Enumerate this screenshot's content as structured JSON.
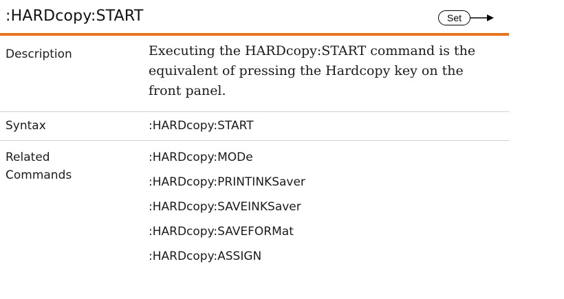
{
  "header": {
    "title": ":HARDcopy:START",
    "badge_label": "Set"
  },
  "description": {
    "label": "Description",
    "text": "Executing the HARDcopy:START command is the equivalent of pressing the Hardcopy key on the front panel."
  },
  "syntax": {
    "label": "Syntax",
    "value": ":HARDcopy:START"
  },
  "related": {
    "label_line1": "Related",
    "label_line2": "Commands",
    "commands": [
      ":HARDcopy:MODe",
      ":HARDcopy:PRINTINKSaver",
      ":HARDcopy:SAVEINKSaver",
      ":HARDcopy:SAVEFORMat",
      ":HARDcopy:ASSIGN"
    ]
  },
  "colors": {
    "accent_rule": "#e8731f",
    "divider": "#cfcfcf"
  },
  "icons": {
    "badge_arrow": "arrow-right-icon"
  }
}
